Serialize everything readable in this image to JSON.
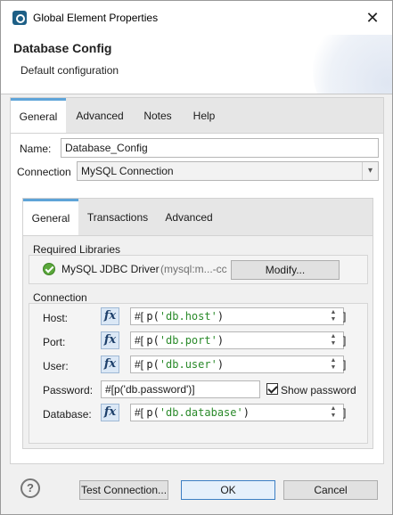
{
  "window": {
    "title": "Global Element Properties",
    "close_glyph": "✕"
  },
  "banner": {
    "title": "Database Config",
    "subtitle": "Default configuration"
  },
  "outer_tabs": [
    {
      "label": "General",
      "active": true
    },
    {
      "label": "Advanced",
      "active": false
    },
    {
      "label": "Notes",
      "active": false
    },
    {
      "label": "Help",
      "active": false
    }
  ],
  "form": {
    "name_label": "Name:",
    "name_value": "Database_Config",
    "connection_label": "Connection",
    "connection_value": "MySQL Connection"
  },
  "inner_tabs": [
    {
      "label": "General",
      "active": true
    },
    {
      "label": "Transactions",
      "active": false
    },
    {
      "label": "Advanced",
      "active": false
    }
  ],
  "libraries": {
    "heading": "Required Libraries",
    "driver_name": "MySQL JDBC Driver",
    "driver_coords": "(mysql:m...-cc",
    "modify_label": "Modify..."
  },
  "connection": {
    "heading": "Connection",
    "fields": [
      {
        "label": "Host:",
        "prefix": "#[",
        "func": "p(",
        "arg": "'db.host'",
        "close": ")"
      },
      {
        "label": "Port:",
        "prefix": "#[",
        "func": "p(",
        "arg": "'db.port'",
        "close": ")"
      },
      {
        "label": "User:",
        "prefix": "#[",
        "func": "p(",
        "arg": "'db.user'",
        "close": ")"
      },
      {
        "label": "Database:",
        "prefix": "#[",
        "func": "p(",
        "arg": "'db.database'",
        "close": ")"
      }
    ],
    "password_label": "Password:",
    "password_value": "#[p('db.password')]",
    "show_password_label": "Show password",
    "show_password_checked": true
  },
  "icons": {
    "fx_label": "fx",
    "help_glyph": "?",
    "spinner_up": "▲",
    "spinner_down": "▼",
    "bracket_close": "]",
    "combo_arrow": "▾"
  },
  "footer": {
    "test_connection_label": "Test Connection...",
    "ok_label": "OK",
    "cancel_label": "Cancel"
  }
}
